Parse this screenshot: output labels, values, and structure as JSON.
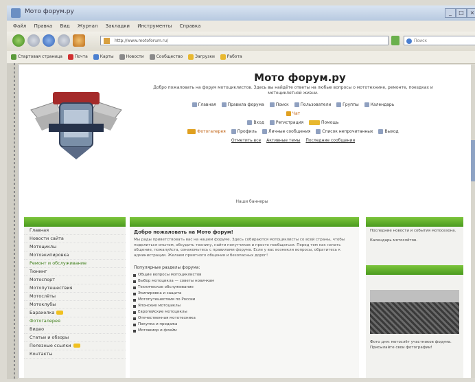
{
  "window": {
    "title": "Мото форум.ру"
  },
  "menu": [
    "Файл",
    "Правка",
    "Вид",
    "Журнал",
    "Закладки",
    "Инструменты",
    "Справка"
  ],
  "address": {
    "url": "http://www.motoforum.ru/",
    "search_placeholder": "Поиск"
  },
  "bookmarks": [
    "Стартовая страница",
    "Почта",
    "Карты",
    "Новости",
    "Сообщество",
    "Загрузки",
    "Работа"
  ],
  "header": {
    "title": "Мото форум.ру",
    "description": "Добро пожаловать на форум мотоциклистов. Здесь вы найдёте ответы на любые вопросы о мототехнике, ремонте, поездках и мотоциклетной жизни.",
    "links_row1": [
      "Главная",
      "Правила форума",
      "Поиск",
      "Пользователи",
      "Группы",
      "Календарь"
    ],
    "link_highlight": "Чат",
    "links_row2": [
      "Вход",
      "Регистрация",
      "Помощь"
    ],
    "links_row3": [
      "Фотогалерея",
      "Профиль",
      "Личные сообщения",
      "Список непрочитанных",
      "Выход"
    ],
    "links_row4": [
      "Отметить все",
      "Активные темы",
      "Последние сообщения"
    ],
    "footer_link": "Наши баннеры"
  },
  "left_menu": {
    "items": [
      {
        "label": "Главная",
        "green": false,
        "badge": false
      },
      {
        "label": "Новости сайта",
        "green": false,
        "badge": false
      },
      {
        "label": "Мотоциклы",
        "green": false,
        "badge": false
      },
      {
        "label": "Мотоэкипировка",
        "green": false,
        "badge": false
      },
      {
        "label": "Ремонт и обслуживание",
        "green": true,
        "badge": false
      },
      {
        "label": "Тюнинг",
        "green": false,
        "badge": false
      },
      {
        "label": "Мотоспорт",
        "green": false,
        "badge": false
      },
      {
        "label": "Мотопутешествия",
        "green": false,
        "badge": false
      },
      {
        "label": "Мотослёты",
        "green": false,
        "badge": false
      },
      {
        "label": "Мотоклубы",
        "green": false,
        "badge": false
      },
      {
        "label": "Барахолка",
        "green": false,
        "badge": true
      },
      {
        "label": "Фотогалерея",
        "green": true,
        "badge": false
      },
      {
        "label": "Видео",
        "green": false,
        "badge": false
      },
      {
        "label": "Статьи и обзоры",
        "green": false,
        "badge": false
      },
      {
        "label": "Полезные ссылки",
        "green": false,
        "badge": true
      },
      {
        "label": "Контакты",
        "green": false,
        "badge": false
      }
    ]
  },
  "main": {
    "intro_title": "Добро пожаловать на Мото форум!",
    "intro_text": "Мы рады приветствовать вас на нашем форуме. Здесь собираются мотоциклисты со всей страны, чтобы поделиться опытом, обсудить технику, найти попутчиков и просто пообщаться. Перед тем как начать общение, пожалуйста, ознакомьтесь с правилами форума. Если у вас возникли вопросы, обратитесь к администрации. Желаем приятного общения и безопасных дорог!",
    "section_title": "Популярные разделы форума:",
    "bullets": [
      "Общие вопросы мотоциклистов",
      "Выбор мотоцикла — советы новичкам",
      "Техническое обслуживание",
      "Экипировка и защита",
      "Мотопутешествия по России",
      "Японские мотоциклы",
      "Европейские мотоциклы",
      "Отечественная мототехника",
      "Покупка и продажа",
      "Мотоюмор и флейм"
    ]
  },
  "right": {
    "box1_text1": "Последние новости и события мотосезона.",
    "box1_text2": "Календарь мотослётов.",
    "box2_text": "Фото дня: мотослёт участников форума. Присылайте свои фотографии!"
  }
}
